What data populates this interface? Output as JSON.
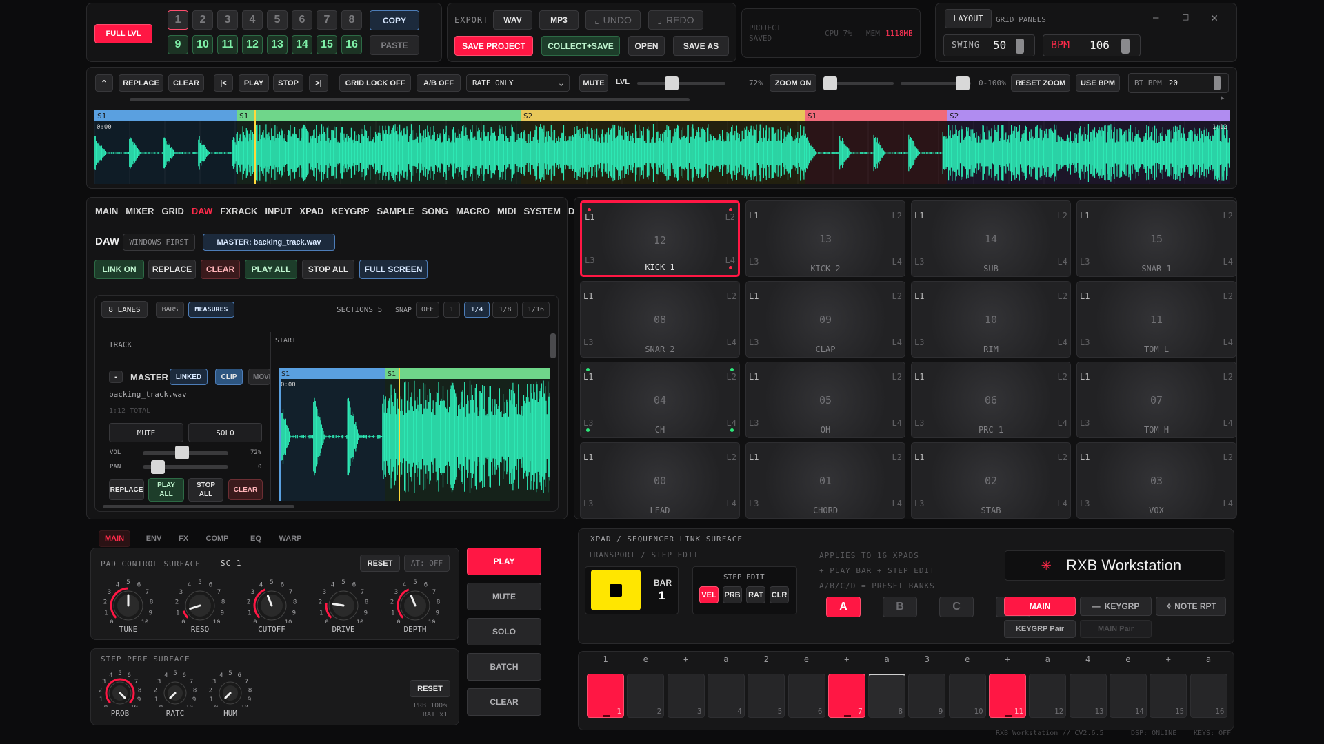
{
  "top": {
    "full_lvl": "FULL LVL",
    "banks": [
      "1",
      "2",
      "3",
      "4",
      "5",
      "6",
      "7",
      "8",
      "9",
      "10",
      "11",
      "12",
      "13",
      "14",
      "15",
      "16"
    ],
    "copy": "COPY",
    "paste": "PASTE"
  },
  "export": {
    "label": "EXPORT",
    "wav": "WAV",
    "mp3": "MP3",
    "undo": "UNDO",
    "redo": "REDO",
    "save_project": "SAVE PROJECT",
    "collect_save": "COLLECT+SAVE",
    "open": "OPEN",
    "save_as": "SAVE AS"
  },
  "status": {
    "project": "PROJECT",
    "saved": "SAVED",
    "cpu": "CPU 7%",
    "mem_label": "MEM",
    "mem_value": "1118MB"
  },
  "layout": {
    "layout_btn": "LAYOUT",
    "grid_panels": "GRID PANELS",
    "swing_label": "SWING",
    "swing_value": "50",
    "bpm_label": "BPM",
    "bpm_value": "106"
  },
  "toolbar": {
    "replace": "REPLACE",
    "clear": "CLEAR",
    "to_start": "|<",
    "play": "PLAY",
    "stop": "STOP",
    "to_end": ">|",
    "grid_lock": "GRID LOCK OFF",
    "ab": "A/B OFF",
    "rate_only": "RATE ONLY",
    "mute": "MUTE",
    "lvl": "LVL",
    "lvl_value": "72%",
    "zoom_on": "ZOOM ON",
    "zoom_range": "0-100%",
    "reset_zoom": "RESET ZOOM",
    "use_bpm": "USE BPM",
    "bt_bpm_label": "BT BPM",
    "bt_bpm_value": "20"
  },
  "timeline": {
    "sections": [
      {
        "label": "S1",
        "color": "#5aa0e0"
      },
      {
        "label": "S1",
        "color": "#6fd68a"
      },
      {
        "label": "S2",
        "color": "#e8c85a"
      },
      {
        "label": "S1",
        "color": "#f06a7a"
      },
      {
        "label": "S2",
        "color": "#b08cf0"
      }
    ],
    "start_time": "0:00",
    "end_time": "1:12"
  },
  "daw": {
    "menu": [
      "MAIN",
      "MIXER",
      "GRID",
      "DAW",
      "FXRACK",
      "INPUT",
      "XPAD",
      "KEYGRP",
      "SAMPLE",
      "SONG",
      "MACRO",
      "MIDI",
      "SYSTEM",
      "DMX"
    ],
    "active_menu": "DAW",
    "title": "DAW",
    "windows_first": "WINDOWS FIRST",
    "master_file": "MASTER: backing_track.wav",
    "link_on": "LINK ON",
    "replace": "REPLACE",
    "clear": "CLEAR",
    "play_all": "PLAY ALL",
    "stop_all": "STOP ALL",
    "full_screen": "FULL SCREEN",
    "lanes": "8 LANES",
    "bars": "BARS",
    "measures": "MEASURES",
    "sections": "SECTIONS 5",
    "snap": "SNAP",
    "snap_opts": [
      "OFF",
      "1",
      "1/4",
      "1/8",
      "1/16"
    ],
    "track_hdr": "TRACK",
    "start_hdr": "START",
    "track_minus": "-",
    "track_name": "MASTER",
    "linked": "LINKED",
    "clip": "CLIP",
    "move": "MOVE",
    "file": "backing_track.wav",
    "total": "1:12 TOTAL",
    "mute": "MUTE",
    "solo": "SOLO",
    "vol": "VOL",
    "vol_val": "72%",
    "pan": "PAN",
    "pan_val": "0",
    "t_replace": "REPLACE",
    "t_play": "PLAY ALL",
    "t_stop": "STOP ALL",
    "t_clear": "CLEAR",
    "clip_sections": [
      "S1",
      "S1"
    ],
    "clip_time": "0:00",
    "vol_level": 0.72,
    "pan_level": 0.5
  },
  "pads": [
    {
      "num": "12",
      "name": "KICK 1",
      "active": true
    },
    {
      "num": "13",
      "name": "KICK 2"
    },
    {
      "num": "14",
      "name": "SUB"
    },
    {
      "num": "15",
      "name": "SNAR 1"
    },
    {
      "num": "08",
      "name": "SNAR 2"
    },
    {
      "num": "09",
      "name": "CLAP"
    },
    {
      "num": "10",
      "name": "RIM"
    },
    {
      "num": "11",
      "name": "TOM L"
    },
    {
      "num": "04",
      "name": "CH"
    },
    {
      "num": "05",
      "name": "OH"
    },
    {
      "num": "06",
      "name": "PRC 1"
    },
    {
      "num": "07",
      "name": "TOM H"
    },
    {
      "num": "00",
      "name": "LEAD"
    },
    {
      "num": "01",
      "name": "CHORD"
    },
    {
      "num": "02",
      "name": "STAB"
    },
    {
      "num": "03",
      "name": "VOX"
    }
  ],
  "pad_corners": [
    "L1",
    "L2",
    "L3",
    "L4"
  ],
  "pad_tabs": [
    "MAIN",
    "ENV",
    "FX",
    "COMP",
    "EQ",
    "WARP"
  ],
  "pad_control": {
    "title": "PAD CONTROL SURFACE",
    "sc": "SC 1",
    "reset": "RESET",
    "at": "AT: OFF",
    "knobs": [
      {
        "name": "TUNE",
        "level": 0.5
      },
      {
        "name": "RESO",
        "level": 0.1
      },
      {
        "name": "CUTOFF",
        "level": 0.42
      },
      {
        "name": "DRIVE",
        "level": 0.2
      },
      {
        "name": "DEPTH",
        "level": 0.42
      }
    ],
    "scale": [
      "0",
      "1",
      "2",
      "3",
      "4",
      "5",
      "6",
      "7",
      "8",
      "9",
      "10"
    ]
  },
  "step_perf": {
    "title": "STEP PERF SURFACE",
    "reset": "RESET",
    "prb": "PRB 100%",
    "rat": "RAT x1",
    "knobs": [
      {
        "name": "PROB",
        "level": 1.0
      },
      {
        "name": "RATC",
        "level": 0.0
      },
      {
        "name": "HUM",
        "level": 0.0
      }
    ]
  },
  "transport": {
    "play": "PLAY",
    "mute": "MUTE",
    "solo": "SOLO",
    "batch": "BATCH",
    "clear": "CLEAR"
  },
  "xpad": {
    "title": "XPAD / SEQUENCER LINK SURFACE",
    "sub": "TRANSPORT / STEP EDIT",
    "bar_label": "BAR",
    "bar_value": "1",
    "step_edit": "STEP EDIT",
    "edit_btns": [
      "VEL",
      "PRB",
      "RAT",
      "CLR"
    ],
    "info": [
      "APPLIES TO 16 XPADS",
      "+ PLAY BAR + STEP EDIT",
      "A/B/C/D = PRESET BANKS"
    ],
    "banks": [
      "A",
      "B",
      "C",
      "D"
    ],
    "brand": "RXB Workstation",
    "main": "MAIN",
    "keygrp": "KEYGRP",
    "note_rpt": "NOTE RPT",
    "keygrp_pair": "KEYGRP Pair",
    "main_pair": "MAIN Pair"
  },
  "sequencer": {
    "beats": [
      "1",
      "e",
      "+",
      "a",
      "2",
      "e",
      "+",
      "a",
      "3",
      "e",
      "+",
      "a",
      "4",
      "e",
      "+",
      "a"
    ],
    "on_steps": [
      1,
      7,
      11
    ],
    "dim_steps": [
      8
    ]
  },
  "footer": {
    "ver": "RXB Workstation // CV2.6.5",
    "dsp": "DSP: ONLINE",
    "keys": "KEYS: OFF"
  },
  "colors": {
    "accent": "#ff1744",
    "wave": "#2de8b4",
    "play_yellow": "#ffe600"
  }
}
